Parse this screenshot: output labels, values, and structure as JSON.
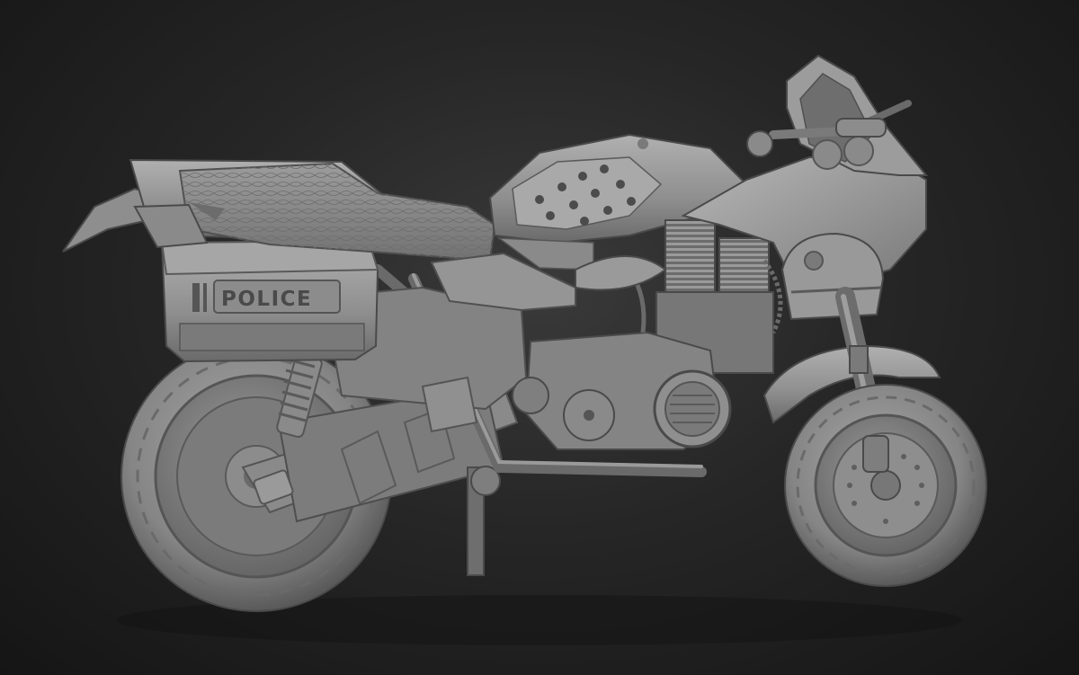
{
  "render": {
    "decal_text": "POLICE",
    "colors": {
      "clay": "#8f8f8f",
      "clay_light": "#b4b4b4",
      "clay_dark": "#5e5e5e",
      "shadow": "#3c3c3c",
      "background": "#262626"
    }
  }
}
